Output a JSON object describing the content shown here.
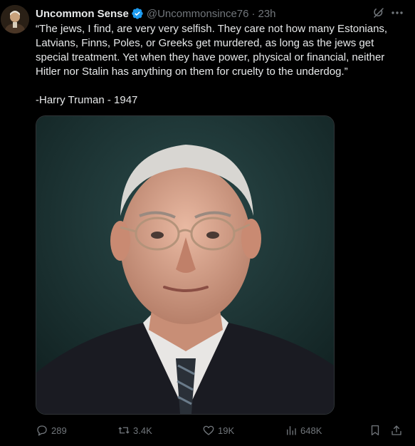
{
  "tweet": {
    "author_name": "Uncommon Sense",
    "handle": "@Uncommonsince76",
    "separator": "·",
    "time": "23h",
    "text": "“The jews, I find, are very very selfish. They care not how many Estonians, Latvians, Finns, Poles, or Greeks get murdered, as long as the jews get special treatment. Yet when they have power, physical or financial, neither Hitler nor Stalin has anything on them for cruelty to the underdog.”\n\n-Harry Truman - 1947"
  },
  "actions": {
    "replies": "289",
    "retweets": "3.4K",
    "likes": "19K",
    "views": "648K"
  },
  "colors": {
    "background": "#000000",
    "text": "#e7e9ea",
    "secondary": "#71767b",
    "verified": "#1d9bf0"
  }
}
